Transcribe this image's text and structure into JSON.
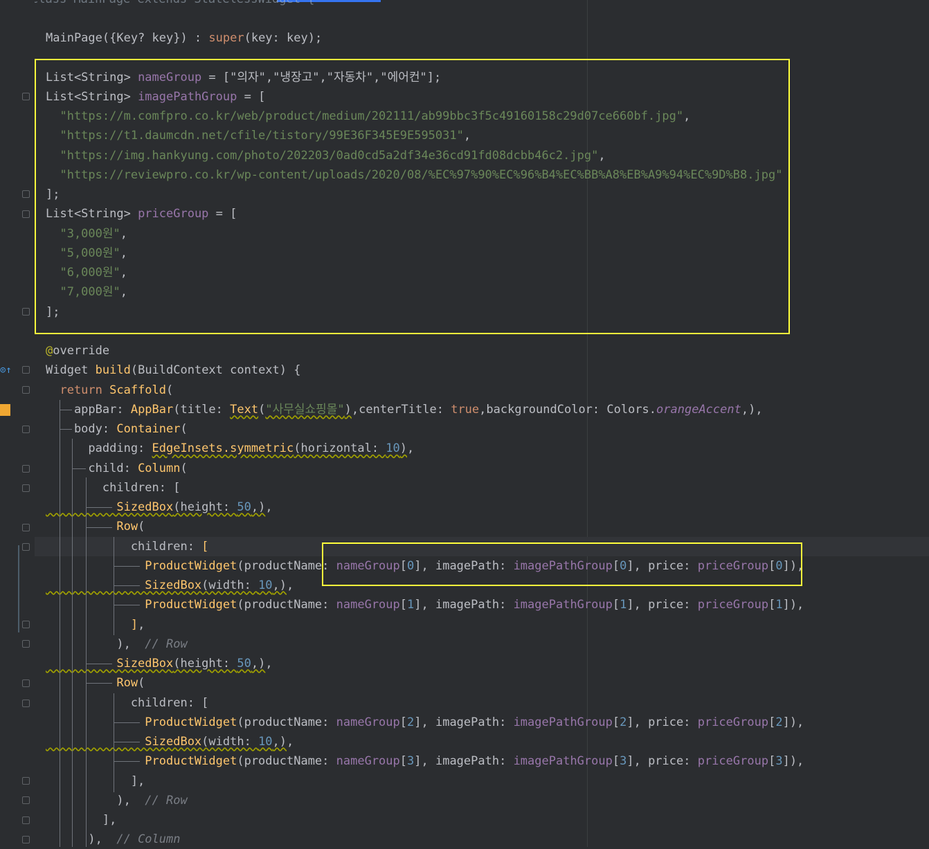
{
  "editor": {
    "top_partial": "class MainPage extends StatelessWidget {",
    "lines": [
      {
        "segs": [
          [
            "p",
            "MainPage({Key? key}) : "
          ],
          [
            "kw",
            "super"
          ],
          [
            "p",
            "(key: key);"
          ]
        ]
      },
      {
        "segs": []
      },
      {
        "segs": [
          [
            "p",
            "List<String> "
          ],
          [
            "fld",
            "nameGroup"
          ],
          [
            "p",
            " = [\"의자\",\"냉장고\",\"자동차\",\"에어컨\"];"
          ]
        ]
      },
      {
        "segs": [
          [
            "p",
            "List<String> "
          ],
          [
            "fld",
            "imagePathGroup"
          ],
          [
            "p",
            " = ["
          ]
        ]
      },
      {
        "segs": [
          [
            "str",
            "  \"https://m.comfpro.co.kr/web/product/medium/202111/ab99bbc3f5c49160158c29d07ce660bf.jpg\""
          ],
          [
            "p",
            ","
          ]
        ]
      },
      {
        "segs": [
          [
            "str",
            "  \"https://t1.daumcdn.net/cfile/tistory/99E36F345E9E595031\""
          ],
          [
            "p",
            ","
          ]
        ]
      },
      {
        "segs": [
          [
            "str",
            "  \"https://img.hankyung.com/photo/202203/0ad0cd5a2df34e36cd91fd08dcbb46c2.jpg\""
          ],
          [
            "p",
            ","
          ]
        ]
      },
      {
        "segs": [
          [
            "str",
            "  \"https://reviewpro.co.kr/wp-content/uploads/2020/08/%EC%97%90%EC%96%B4%EC%BB%A8%EB%A9%94%EC%9D%B8.jpg\""
          ]
        ]
      },
      {
        "segs": [
          [
            "p",
            "];"
          ]
        ]
      },
      {
        "segs": [
          [
            "p",
            "List<String> "
          ],
          [
            "fld",
            "priceGroup"
          ],
          [
            "p",
            " = ["
          ]
        ]
      },
      {
        "segs": [
          [
            "str",
            "  \"3,000원\""
          ],
          [
            "p",
            ","
          ]
        ]
      },
      {
        "segs": [
          [
            "str",
            "  \"5,000원\""
          ],
          [
            "p",
            ","
          ]
        ]
      },
      {
        "segs": [
          [
            "str",
            "  \"6,000원\""
          ],
          [
            "p",
            ","
          ]
        ]
      },
      {
        "segs": [
          [
            "str",
            "  \"7,000원\""
          ],
          [
            "p",
            ","
          ]
        ]
      },
      {
        "segs": [
          [
            "p",
            "];"
          ]
        ]
      },
      {
        "segs": []
      },
      {
        "segs": [
          [
            "ann",
            "@"
          ],
          [
            "p",
            "override"
          ]
        ]
      },
      {
        "segs": [
          [
            "p",
            "Widget "
          ],
          [
            "fn",
            "build"
          ],
          [
            "p",
            "(BuildContext context) {"
          ]
        ]
      },
      {
        "segs": [
          [
            "kw",
            "  return "
          ],
          [
            "fn",
            "Scaffold"
          ],
          [
            "p",
            "("
          ]
        ]
      },
      {
        "segs": [
          [
            "p",
            "    appBar: "
          ],
          [
            "fn",
            "AppBar"
          ],
          [
            "p",
            "(title: "
          ],
          [
            "fnw",
            "Text"
          ],
          [
            "p",
            "("
          ],
          [
            "strw",
            "\"사무실쇼핑몰\""
          ],
          [
            "pw",
            ")"
          ],
          [
            "p",
            ",centerTitle: "
          ],
          [
            "kw",
            "true"
          ],
          [
            "p",
            ",backgroundColor: Colors."
          ],
          [
            "ital",
            "orangeAccent"
          ],
          [
            "p",
            ",),"
          ]
        ]
      },
      {
        "segs": [
          [
            "p",
            "    body: "
          ],
          [
            "fn",
            "Container"
          ],
          [
            "p",
            "("
          ]
        ]
      },
      {
        "segs": [
          [
            "p",
            "      padding: "
          ],
          [
            "fnw",
            "EdgeInsets.symmetric"
          ],
          [
            "pw",
            "(horizontal: "
          ],
          [
            "numw",
            "10"
          ],
          [
            "pw",
            ")"
          ],
          [
            "p",
            ","
          ]
        ]
      },
      {
        "segs": [
          [
            "p",
            "      child: "
          ],
          [
            "fn",
            "Column"
          ],
          [
            "p",
            "("
          ]
        ]
      },
      {
        "segs": [
          [
            "p",
            "        children: ["
          ]
        ]
      },
      {
        "segs": [
          [
            "fnw",
            "          SizedBox"
          ],
          [
            "pw",
            "(height: "
          ],
          [
            "numw",
            "50"
          ],
          [
            "pw",
            ",)"
          ],
          [
            "p",
            ","
          ]
        ]
      },
      {
        "segs": [
          [
            "fn",
            "          Row"
          ],
          [
            "p",
            "("
          ]
        ]
      },
      {
        "segs": [
          [
            "p",
            "            children: "
          ],
          [
            "fn",
            "["
          ]
        ]
      },
      {
        "segs": [
          [
            "fn",
            "              ProductWidget"
          ],
          [
            "p",
            "(productName: "
          ],
          [
            "fld",
            "nameGroup"
          ],
          [
            "p",
            "["
          ],
          [
            "num",
            "0"
          ],
          [
            "p",
            "], imagePath: "
          ],
          [
            "fld",
            "imagePathGroup"
          ],
          [
            "p",
            "["
          ],
          [
            "num",
            "0"
          ],
          [
            "p",
            "], price: "
          ],
          [
            "fld",
            "priceGroup"
          ],
          [
            "p",
            "["
          ],
          [
            "num",
            "0"
          ],
          [
            "p",
            "]),"
          ]
        ]
      },
      {
        "segs": [
          [
            "fnw",
            "              SizedBox"
          ],
          [
            "pw",
            "(width: "
          ],
          [
            "numw",
            "10"
          ],
          [
            "pw",
            ",)"
          ],
          [
            "p",
            ","
          ]
        ]
      },
      {
        "segs": [
          [
            "fn",
            "              ProductWidget"
          ],
          [
            "p",
            "(productName: "
          ],
          [
            "fld",
            "nameGroup"
          ],
          [
            "p",
            "["
          ],
          [
            "num",
            "1"
          ],
          [
            "p",
            "], imagePath: "
          ],
          [
            "fld",
            "imagePathGroup"
          ],
          [
            "p",
            "["
          ],
          [
            "num",
            "1"
          ],
          [
            "p",
            "], price: "
          ],
          [
            "fld",
            "priceGroup"
          ],
          [
            "p",
            "["
          ],
          [
            "num",
            "1"
          ],
          [
            "p",
            "]),"
          ]
        ]
      },
      {
        "segs": [
          [
            "fn",
            "            ]"
          ],
          [
            "p",
            ","
          ]
        ]
      },
      {
        "segs": [
          [
            "p",
            "          ),  "
          ],
          [
            "cm",
            "// Row"
          ]
        ]
      },
      {
        "segs": [
          [
            "fnw",
            "          SizedBox"
          ],
          [
            "pw",
            "(height: "
          ],
          [
            "numw",
            "50"
          ],
          [
            "pw",
            ",)"
          ],
          [
            "p",
            ","
          ]
        ]
      },
      {
        "segs": [
          [
            "fn",
            "          Row"
          ],
          [
            "p",
            "("
          ]
        ]
      },
      {
        "segs": [
          [
            "p",
            "            children: ["
          ]
        ]
      },
      {
        "segs": [
          [
            "fn",
            "              ProductWidget"
          ],
          [
            "p",
            "(productName: "
          ],
          [
            "fld",
            "nameGroup"
          ],
          [
            "p",
            "["
          ],
          [
            "num",
            "2"
          ],
          [
            "p",
            "], imagePath: "
          ],
          [
            "fld",
            "imagePathGroup"
          ],
          [
            "p",
            "["
          ],
          [
            "num",
            "2"
          ],
          [
            "p",
            "], price: "
          ],
          [
            "fld",
            "priceGroup"
          ],
          [
            "p",
            "["
          ],
          [
            "num",
            "2"
          ],
          [
            "p",
            "]),"
          ]
        ]
      },
      {
        "segs": [
          [
            "fnw",
            "              SizedBox"
          ],
          [
            "pw",
            "(width: "
          ],
          [
            "numw",
            "10"
          ],
          [
            "pw",
            ",)"
          ],
          [
            "p",
            ","
          ]
        ]
      },
      {
        "segs": [
          [
            "fn",
            "              ProductWidget"
          ],
          [
            "p",
            "(productName: "
          ],
          [
            "fld",
            "nameGroup"
          ],
          [
            "p",
            "["
          ],
          [
            "num",
            "3"
          ],
          [
            "p",
            "], imagePath: "
          ],
          [
            "fld",
            "imagePathGroup"
          ],
          [
            "p",
            "["
          ],
          [
            "num",
            "3"
          ],
          [
            "p",
            "], price: "
          ],
          [
            "fld",
            "priceGroup"
          ],
          [
            "p",
            "["
          ],
          [
            "num",
            "3"
          ],
          [
            "p",
            "]),"
          ]
        ]
      },
      {
        "segs": [
          [
            "p",
            "            ],"
          ]
        ]
      },
      {
        "segs": [
          [
            "p",
            "          ),  "
          ],
          [
            "cm",
            "// Row"
          ]
        ]
      },
      {
        "segs": [
          [
            "p",
            "        ],"
          ]
        ]
      },
      {
        "segs": [
          [
            "p",
            "      ),  "
          ],
          [
            "cm",
            "// Column"
          ]
        ]
      }
    ]
  },
  "colors": {
    "background": "#2b2d30",
    "highlight_box": "#ffff3b",
    "bookmark": "#f0a732",
    "override_marker": "#4a9ee8"
  },
  "icons": {
    "override_marker": "override-gutter-icon",
    "bookmark_marker": "bookmark-gutter-icon"
  }
}
